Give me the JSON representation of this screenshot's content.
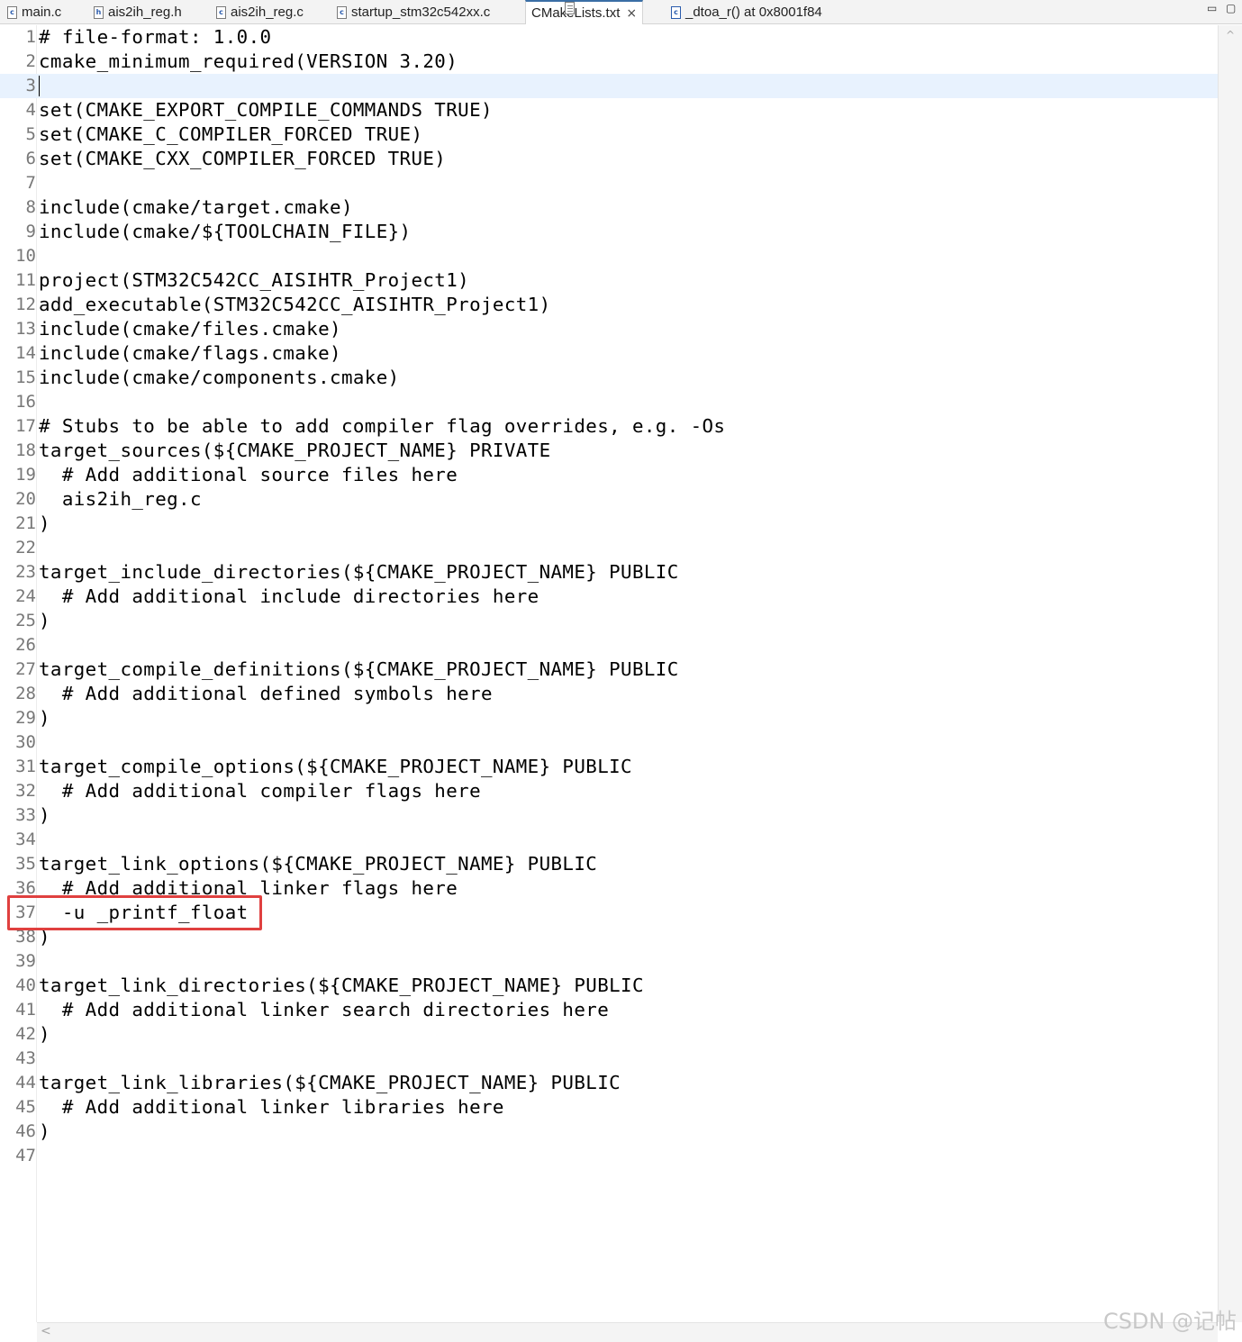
{
  "tabs": [
    {
      "label": "main.c",
      "icon": "c-file-icon",
      "active": false
    },
    {
      "label": "ais2ih_reg.h",
      "icon": "h-file-icon",
      "active": false
    },
    {
      "label": "ais2ih_reg.c",
      "icon": "c-file-icon",
      "active": false
    },
    {
      "label": "startup_stm32c542xx.c",
      "icon": "c-file-icon",
      "active": false
    },
    {
      "label": "CMakeLists.txt",
      "icon": "text-file-icon",
      "active": true,
      "close": "×"
    },
    {
      "label": "_dtoa_r() at 0x8001f84",
      "icon": "disassembly-icon",
      "active": false
    }
  ],
  "window_controls": {
    "minimize": "▭",
    "maximize": "▢"
  },
  "editor": {
    "current_line": 3,
    "highlighted_line": 37,
    "lines": [
      {
        "n": "1",
        "text": "# file-format: 1.0.0"
      },
      {
        "n": "2",
        "text": "cmake_minimum_required(VERSION 3.20)"
      },
      {
        "n": "3",
        "text": ""
      },
      {
        "n": "4",
        "text": "set(CMAKE_EXPORT_COMPILE_COMMANDS TRUE)"
      },
      {
        "n": "5",
        "text": "set(CMAKE_C_COMPILER_FORCED TRUE)"
      },
      {
        "n": "6",
        "text": "set(CMAKE_CXX_COMPILER_FORCED TRUE)"
      },
      {
        "n": "7",
        "text": ""
      },
      {
        "n": "8",
        "text": "include(cmake/target.cmake)"
      },
      {
        "n": "9",
        "text": "include(cmake/${TOOLCHAIN_FILE})"
      },
      {
        "n": "10",
        "text": ""
      },
      {
        "n": "11",
        "text": "project(STM32C542CC_AISIHTR_Project1)"
      },
      {
        "n": "12",
        "text": "add_executable(STM32C542CC_AISIHTR_Project1)"
      },
      {
        "n": "13",
        "text": "include(cmake/files.cmake)"
      },
      {
        "n": "14",
        "text": "include(cmake/flags.cmake)"
      },
      {
        "n": "15",
        "text": "include(cmake/components.cmake)"
      },
      {
        "n": "16",
        "text": ""
      },
      {
        "n": "17",
        "text": "# Stubs to be able to add compiler flag overrides, e.g. -Os"
      },
      {
        "n": "18",
        "text": "target_sources(${CMAKE_PROJECT_NAME} PRIVATE"
      },
      {
        "n": "19",
        "text": "  # Add additional source files here"
      },
      {
        "n": "20",
        "text": "  ais2ih_reg.c"
      },
      {
        "n": "21",
        "text": ")"
      },
      {
        "n": "22",
        "text": ""
      },
      {
        "n": "23",
        "text": "target_include_directories(${CMAKE_PROJECT_NAME} PUBLIC"
      },
      {
        "n": "24",
        "text": "  # Add additional include directories here"
      },
      {
        "n": "25",
        "text": ")"
      },
      {
        "n": "26",
        "text": ""
      },
      {
        "n": "27",
        "text": "target_compile_definitions(${CMAKE_PROJECT_NAME} PUBLIC"
      },
      {
        "n": "28",
        "text": "  # Add additional defined symbols here"
      },
      {
        "n": "29",
        "text": ")"
      },
      {
        "n": "30",
        "text": ""
      },
      {
        "n": "31",
        "text": "target_compile_options(${CMAKE_PROJECT_NAME} PUBLIC"
      },
      {
        "n": "32",
        "text": "  # Add additional compiler flags here"
      },
      {
        "n": "33",
        "text": ")"
      },
      {
        "n": "34",
        "text": ""
      },
      {
        "n": "35",
        "text": "target_link_options(${CMAKE_PROJECT_NAME} PUBLIC"
      },
      {
        "n": "36",
        "text": "  # Add additional linker flags here"
      },
      {
        "n": "37",
        "text": "  -u _printf_float"
      },
      {
        "n": "38",
        "text": ")"
      },
      {
        "n": "39",
        "text": ""
      },
      {
        "n": "40",
        "text": "target_link_directories(${CMAKE_PROJECT_NAME} PUBLIC"
      },
      {
        "n": "41",
        "text": "  # Add additional linker search directories here"
      },
      {
        "n": "42",
        "text": ")"
      },
      {
        "n": "43",
        "text": ""
      },
      {
        "n": "44",
        "text": "target_link_libraries(${CMAKE_PROJECT_NAME} PUBLIC"
      },
      {
        "n": "45",
        "text": "  # Add additional linker libraries here"
      },
      {
        "n": "46",
        "text": ")"
      },
      {
        "n": "47",
        "text": ""
      }
    ]
  },
  "scrollbars": {
    "up_arrow": "^",
    "left_arrow": "<"
  },
  "watermark": "CSDN @记帖",
  "colors": {
    "highlight_box": "#e0403f",
    "current_line_bg": "#e8f2fe",
    "line_number": "#787878"
  }
}
